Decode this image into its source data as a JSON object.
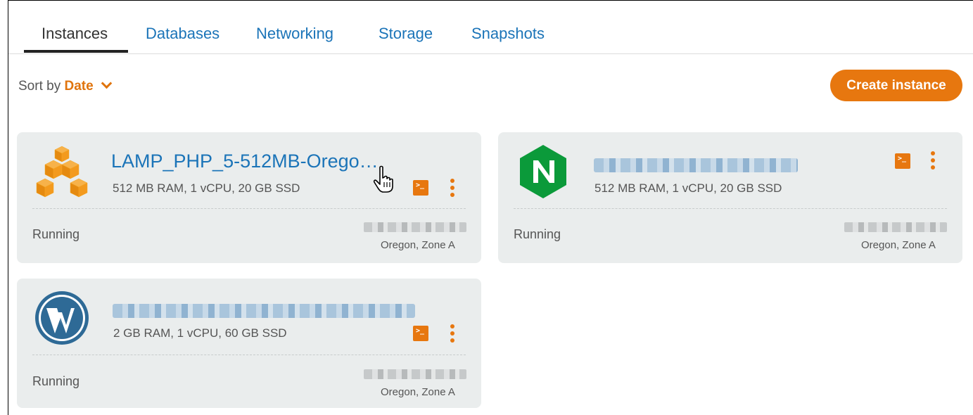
{
  "tabs": [
    {
      "label": "Instances",
      "active": true
    },
    {
      "label": "Databases",
      "active": false
    },
    {
      "label": "Networking",
      "active": false
    },
    {
      "label": "Storage",
      "active": false
    },
    {
      "label": "Snapshots",
      "active": false
    }
  ],
  "sort": {
    "prefix": "Sort by",
    "value": "Date"
  },
  "create_button": "Create instance",
  "colors": {
    "accent": "#e7770f",
    "link": "#1b74b8",
    "card_bg": "#eaeded"
  },
  "instances": [
    {
      "name": "LAMP_PHP_5-512MB-Orego…",
      "icon": "lamp-cubes-icon",
      "specs": "512 MB RAM, 1 vCPU, 20 GB SSD",
      "status": "Running",
      "zone": "Oregon, Zone A"
    },
    {
      "name": "",
      "icon": "nginx-icon",
      "specs": "512 MB RAM, 1 vCPU, 20 GB SSD",
      "status": "Running",
      "zone": "Oregon, Zone A"
    },
    {
      "name": "",
      "icon": "wordpress-icon",
      "specs": "2 GB RAM, 1 vCPU, 60 GB SSD",
      "status": "Running",
      "zone": "Oregon, Zone A"
    }
  ]
}
